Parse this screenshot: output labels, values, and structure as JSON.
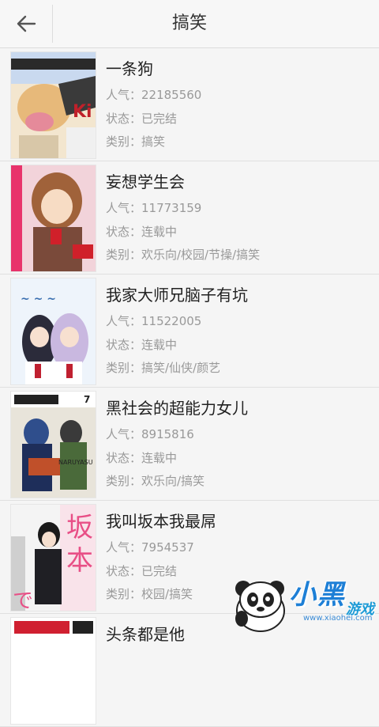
{
  "header": {
    "title": "搞笑",
    "back_icon": "arrow-left-icon"
  },
  "comics": [
    {
      "name": "一条狗",
      "popularity": "人气：22185560",
      "status": "状态：已完结",
      "category": "类别：搞笑"
    },
    {
      "name": "妄想学生会",
      "popularity": "人气：11773159",
      "status": "状态：连载中",
      "category": "类别：欢乐向/校园/节操/搞笑"
    },
    {
      "name": "我家大师兄脑子有坑",
      "popularity": "人气：11522005",
      "status": "状态：连载中",
      "category": "类别：搞笑/仙侠/颜艺"
    },
    {
      "name": "黑社会的超能力女儿",
      "popularity": "人气：8915816",
      "status": "状态：连载中",
      "category": "类别：欢乐向/搞笑"
    },
    {
      "name": "我叫坂本我最屌",
      "popularity": "人气：7954537",
      "status": "状态：已完结",
      "category": "类别：校园/搞笑"
    },
    {
      "name": "头条都是他",
      "popularity": "",
      "status": "",
      "category": ""
    }
  ],
  "watermark": {
    "brand": "小黑",
    "sub": "游戏",
    "url": "www.xiaohei.com"
  }
}
